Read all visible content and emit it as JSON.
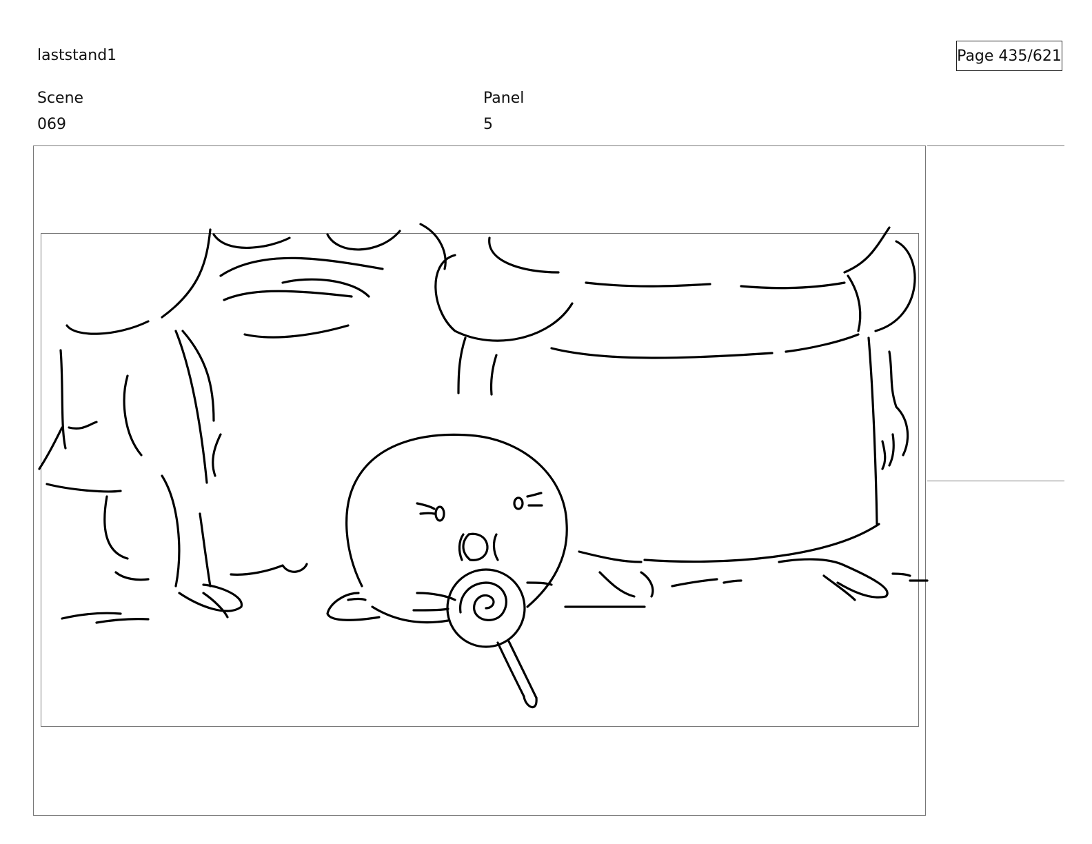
{
  "header": {
    "project_name": "laststand1",
    "page_indicator": "Page 435/621"
  },
  "fields": {
    "scene_label": "Scene",
    "scene_value": "069",
    "panel_label": "Panel",
    "panel_value": "5"
  }
}
